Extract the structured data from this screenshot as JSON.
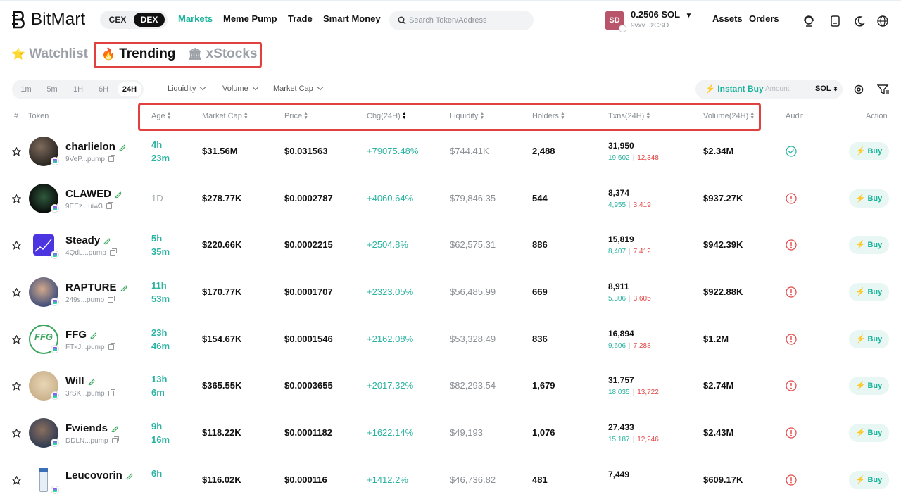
{
  "brand": {
    "name": "BitMart"
  },
  "header": {
    "toggle": {
      "cex": "CEX",
      "dex": "DEX"
    },
    "nav": [
      "Markets",
      "Meme Pump",
      "Trade",
      "Smart Money"
    ],
    "search_placeholder": "Search Token/Address",
    "wallet": {
      "avatar": "SD",
      "balance": "0.2506 SOL",
      "address": "9vxv...zCSD"
    },
    "links": [
      "Assets",
      "Orders"
    ],
    "icons": [
      "support-icon",
      "wallet-icon",
      "moon-icon",
      "globe-icon"
    ]
  },
  "tabs": [
    {
      "icon": "⭐",
      "label": "Watchlist"
    },
    {
      "icon": "🔥",
      "label": "Trending"
    },
    {
      "icon": "🏛",
      "label": "xStocks"
    }
  ],
  "timeframes": [
    "1m",
    "5m",
    "1H",
    "6H",
    "24H"
  ],
  "active_timeframe": "24H",
  "filters": [
    "Liquidity",
    "Volume",
    "Market Cap"
  ],
  "instant_buy": {
    "label": "Instant Buy",
    "placeholder": "Amount",
    "currency": "SOL"
  },
  "columns": [
    "#",
    "Token",
    "Age",
    "Market Cap",
    "Price",
    "Chg(24H)",
    "Liquidity",
    "Holders",
    "Txns(24H)",
    "Volume(24H)",
    "Audit",
    "Action"
  ],
  "colors": {
    "accent": "#19b39b",
    "up": "#2ab3a0",
    "down": "#e24646",
    "highlight": "#e0413f"
  },
  "rows": [
    {
      "name": "charlielon",
      "addr": "9VeP...pump",
      "age1": "4h",
      "age2": "23m",
      "mcap": "$31.56M",
      "price": "$0.031563",
      "chg": "+79075.48%",
      "liq": "$744.41K",
      "holders": "2,488",
      "txns": "31,950",
      "buys": "19,602",
      "sells": "12,348",
      "vol": "$2.34M",
      "audit": "check",
      "buy": "Buy"
    },
    {
      "name": "CLAWED",
      "addr": "9EEz...uiw3",
      "age1": "1D",
      "age2": "",
      "mcap": "$278.77K",
      "price": "$0.0002787",
      "chg": "+4060.64%",
      "liq": "$79,846.35",
      "holders": "544",
      "txns": "8,374",
      "buys": "4,955",
      "sells": "3,419",
      "vol": "$937.27K",
      "audit": "warn",
      "buy": "Buy"
    },
    {
      "name": "Steady",
      "addr": "4QdL...pump",
      "age1": "5h",
      "age2": "35m",
      "mcap": "$220.66K",
      "price": "$0.0002215",
      "chg": "+2504.8%",
      "liq": "$62,575.31",
      "holders": "886",
      "txns": "15,819",
      "buys": "8,407",
      "sells": "7,412",
      "vol": "$942.39K",
      "audit": "warn",
      "buy": "Buy"
    },
    {
      "name": "RAPTURE",
      "addr": "249s...pump",
      "age1": "11h",
      "age2": "53m",
      "mcap": "$170.77K",
      "price": "$0.0001707",
      "chg": "+2323.05%",
      "liq": "$56,485.99",
      "holders": "669",
      "txns": "8,911",
      "buys": "5,306",
      "sells": "3,605",
      "vol": "$922.88K",
      "audit": "warn",
      "buy": "Buy"
    },
    {
      "name": "FFG",
      "addr": "FTkJ...pump",
      "age1": "23h",
      "age2": "46m",
      "mcap": "$154.67K",
      "price": "$0.0001546",
      "chg": "+2162.08%",
      "liq": "$53,328.49",
      "holders": "836",
      "txns": "16,894",
      "buys": "9,606",
      "sells": "7,288",
      "vol": "$1.2M",
      "audit": "warn",
      "buy": "Buy"
    },
    {
      "name": "Will",
      "addr": "3rSK...pump",
      "age1": "13h",
      "age2": "6m",
      "mcap": "$365.55K",
      "price": "$0.0003655",
      "chg": "+2017.32%",
      "liq": "$82,293.54",
      "holders": "1,679",
      "txns": "31,757",
      "buys": "18,035",
      "sells": "13,722",
      "vol": "$2.74M",
      "audit": "warn",
      "buy": "Buy"
    },
    {
      "name": "Fwiends",
      "addr": "DDLN...pump",
      "age1": "9h",
      "age2": "16m",
      "mcap": "$118.22K",
      "price": "$0.0001182",
      "chg": "+1622.14%",
      "liq": "$49,193",
      "holders": "1,076",
      "txns": "27,433",
      "buys": "15,187",
      "sells": "12,246",
      "vol": "$2.43M",
      "audit": "warn",
      "buy": "Buy"
    },
    {
      "name": "Leucovorin",
      "addr": "",
      "age1": "6h",
      "age2": "",
      "mcap": "$116.02K",
      "price": "$0.000116",
      "chg": "+1412.2%",
      "liq": "$46,736.82",
      "holders": "481",
      "txns": "7,449",
      "buys": "",
      "sells": "",
      "vol": "$609.17K",
      "audit": "warn",
      "buy": "Buy"
    }
  ]
}
